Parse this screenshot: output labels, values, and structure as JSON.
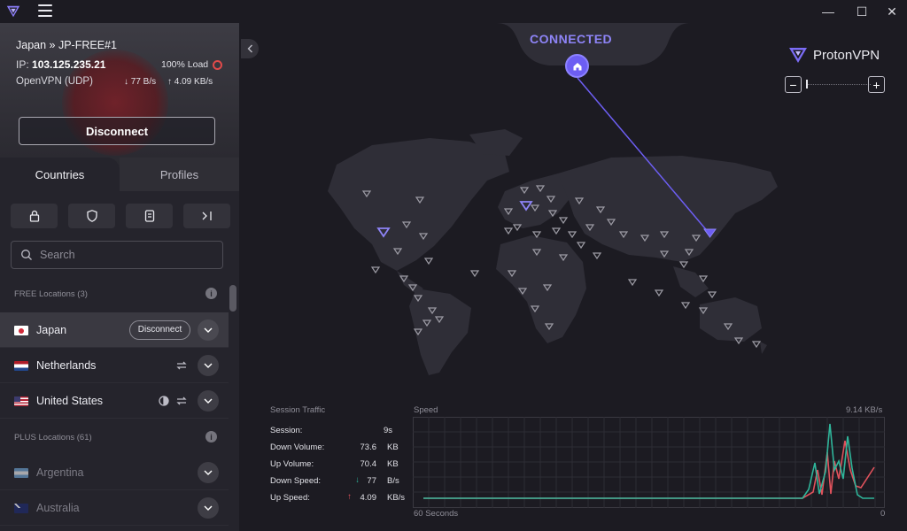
{
  "app": {
    "title_icons": {
      "logo": "proton-vpn-logo-icon",
      "menu": "hamburger-menu-icon"
    },
    "window_controls": {
      "minimize": "—",
      "maximize": "☐",
      "close": "✕"
    }
  },
  "connection": {
    "title": "Japan » JP-FREE#1",
    "ip_label": "IP:",
    "ip": "103.125.235.21",
    "load": "100% Load",
    "protocol": "OpenVPN (UDP)",
    "down_speed": "77 B/s",
    "up_speed": "4.09 KB/s",
    "disconnect_label": "Disconnect"
  },
  "tabs": [
    {
      "label": "Countries",
      "active": true
    },
    {
      "label": "Profiles",
      "active": false
    }
  ],
  "filters": [
    "lock-icon",
    "shield-icon",
    "secure-core-icon",
    "split-tunnel-icon"
  ],
  "search": {
    "placeholder": "Search"
  },
  "sections": {
    "free": "FREE Locations (3)",
    "plus": "PLUS Locations (61)"
  },
  "countries": [
    {
      "name": "Japan",
      "action": "Disconnect",
      "active": true
    },
    {
      "name": "Netherlands"
    },
    {
      "name": "United States"
    },
    {
      "name": "Argentina"
    },
    {
      "name": "Australia"
    }
  ],
  "map": {
    "status": "CONNECTED",
    "brand": "ProtonVPN",
    "zoom_out": "−",
    "zoom_in": "+"
  },
  "traffic": {
    "title": "Session Traffic",
    "rows": [
      {
        "label": "Session:",
        "value": "9s",
        "unit": ""
      },
      {
        "label": "Down Volume:",
        "value": "73.6",
        "unit": "KB"
      },
      {
        "label": "Up Volume:",
        "value": "70.4",
        "unit": "KB"
      },
      {
        "label": "Down Speed:",
        "value": "77",
        "unit": "B/s"
      },
      {
        "label": "Up Speed:",
        "value": "4.09",
        "unit": "KB/s"
      }
    ],
    "speed_label": "Speed",
    "max_label": "9.14  KB/s",
    "x_left": "60 Seconds",
    "x_right": "0",
    "colors": {
      "down": "#2fb59a",
      "up": "#e0525c",
      "accent": "#7b6cf6"
    }
  }
}
